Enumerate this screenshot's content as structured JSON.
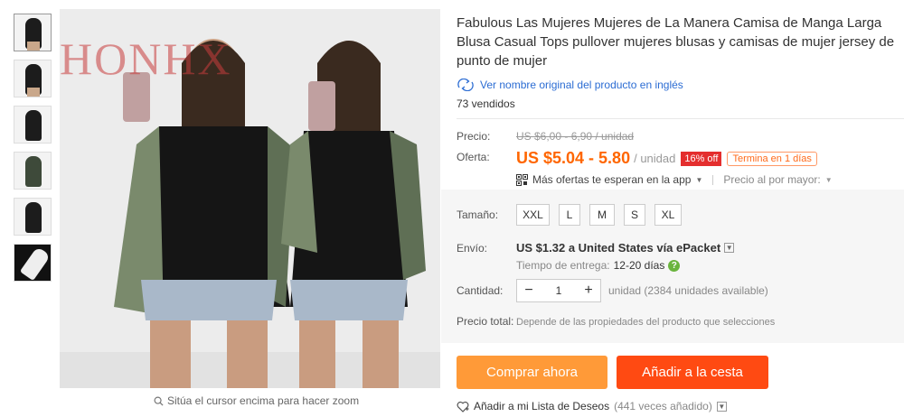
{
  "product": {
    "title": "Fabulous Las Mujeres Mujeres de La Manera Camisa de Manga Larga Blusa Casual Tops pullover mujeres blusas y camisas de mujer jersey de punto de mujer",
    "original_link": "Ver nombre original del producto en inglés",
    "sold": "73 vendidos",
    "watermark": "HONHX"
  },
  "gallery": {
    "zoom_hint": "Sitúa el cursor encima para hacer zoom",
    "thumbnails": [
      "thumb-1",
      "thumb-2",
      "thumb-3",
      "thumb-4",
      "thumb-5",
      "thumb-6"
    ]
  },
  "pricing": {
    "price_label": "Precio:",
    "old_price": "US $6,00 - 6,90 / unidad",
    "offer_label": "Oferta:",
    "offer_price": "US $5.04 - 5.80",
    "unit": "/ unidad",
    "discount": "16% off",
    "ends": "Termina en 1 días",
    "app_offers": "Más ofertas te esperan en la app",
    "bulk_price": "Precio al por mayor:"
  },
  "sizes": {
    "label": "Tamaño:",
    "options": [
      "XXL",
      "L",
      "M",
      "S",
      "XL"
    ]
  },
  "shipping": {
    "label": "Envío:",
    "main": "US $1.32 a United States vía ePacket",
    "delivery_label": "Tiempo de entrega:",
    "delivery_days": "12-20 días"
  },
  "quantity": {
    "label": "Cantidad:",
    "value": "1",
    "minus": "−",
    "plus": "+",
    "available": "unidad (2384 unidades available)"
  },
  "total": {
    "label": "Precio total:",
    "text": "Depende de las propiedades del producto que selecciones"
  },
  "actions": {
    "buy_now": "Comprar ahora",
    "add_to_cart": "Añadir a la cesta",
    "wishlist": "Añadir a mi Lista de Deseos",
    "wishlist_count": "(441 veces añadido)"
  },
  "colors": {
    "accent": "#ff6600",
    "buy": "#ff9a38",
    "cart": "#ff4a12",
    "discount": "#e42e2e",
    "link": "#2b6cd3"
  }
}
